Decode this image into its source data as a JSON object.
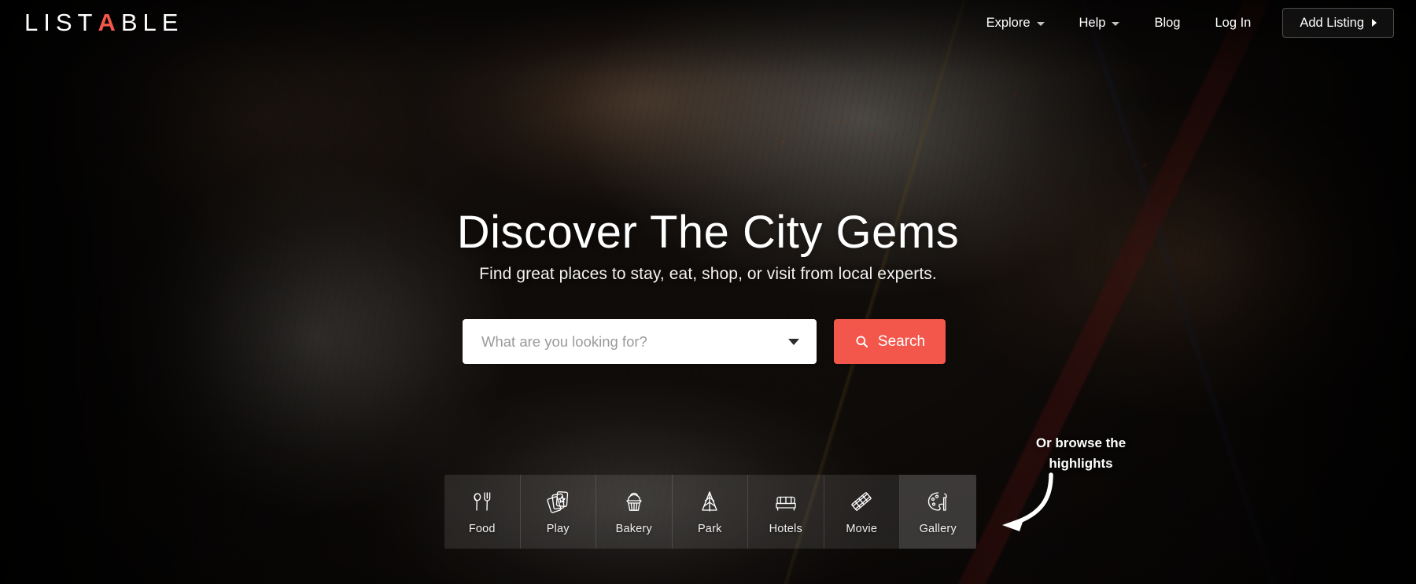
{
  "brand": {
    "name_before": "LIST",
    "name_mark": "A",
    "name_after": "BLE",
    "accent_color": "#f3564a"
  },
  "nav": {
    "items": [
      {
        "label": "Explore",
        "has_dropdown": true
      },
      {
        "label": "Help",
        "has_dropdown": true
      },
      {
        "label": "Blog",
        "has_dropdown": false
      },
      {
        "label": "Log In",
        "has_dropdown": false
      }
    ],
    "cta": {
      "label": "Add Listing",
      "icon": "caret-right-icon"
    }
  },
  "hero": {
    "title": "Discover The City Gems",
    "subtitle": "Find great places to stay, eat, shop, or visit from local experts."
  },
  "search": {
    "placeholder": "What are you looking for?",
    "value": "",
    "button_label": "Search",
    "button_color": "#f3564a",
    "dropdown_icon": "chevron-down-icon",
    "search_icon": "search-icon"
  },
  "browse_hint": {
    "line1": "Or browse the",
    "line2": "highlights",
    "arrow_icon": "curved-arrow-left-icon"
  },
  "categories": {
    "items": [
      {
        "label": "Food",
        "icon": "spoon-fork-icon",
        "active": false
      },
      {
        "label": "Play",
        "icon": "playing-cards-icon",
        "active": false
      },
      {
        "label": "Bakery",
        "icon": "cupcake-icon",
        "active": false
      },
      {
        "label": "Park",
        "icon": "tree-icon",
        "active": false
      },
      {
        "label": "Hotels",
        "icon": "bed-icon",
        "active": false
      },
      {
        "label": "Movie",
        "icon": "film-strip-icon",
        "active": false
      },
      {
        "label": "Gallery",
        "icon": "palette-icon",
        "active": true
      }
    ]
  }
}
